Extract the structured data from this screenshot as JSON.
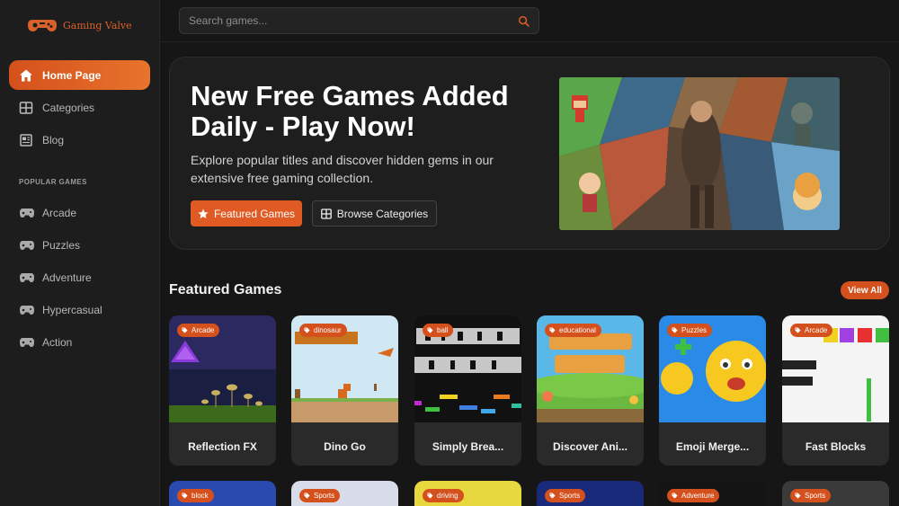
{
  "brand": {
    "name": "Gaming Valve"
  },
  "search": {
    "placeholder": "Search games..."
  },
  "nav": [
    {
      "label": "Home Page",
      "icon": "home-icon",
      "active": true
    },
    {
      "label": "Categories",
      "icon": "grid-icon"
    },
    {
      "label": "Blog",
      "icon": "newspaper-icon"
    }
  ],
  "popular": {
    "label": "POPULAR GAMES",
    "items": [
      "Arcade",
      "Puzzles",
      "Adventure",
      "Hypercasual",
      "Action"
    ]
  },
  "hero": {
    "title": "New Free Games Added Daily - Play Now!",
    "subtitle": "Explore popular titles and discover hidden gems in our extensive free gaming collection.",
    "featured_button": "Featured Games",
    "browse_button": "Browse Categories"
  },
  "featured": {
    "title": "Featured Games",
    "view_all": "View All",
    "games": [
      {
        "name": "Reflection FX",
        "tag": "Arcade"
      },
      {
        "name": "Dino Go",
        "tag": "dinosaur"
      },
      {
        "name": "Simply Brea...",
        "tag": "ball"
      },
      {
        "name": "Discover Ani...",
        "tag": "educational"
      },
      {
        "name": "Emoji Merge...",
        "tag": "Puzzles"
      },
      {
        "name": "Fast Blocks",
        "tag": "Arcade"
      }
    ],
    "next_row_tags": [
      "block",
      "Sports",
      "driving",
      "Sports",
      "Adventure",
      "Sports"
    ]
  },
  "colors": {
    "accent": "#e05a24",
    "background": "#161616",
    "sidebar": "#1d1d1d",
    "card": "#2a2a2a"
  }
}
